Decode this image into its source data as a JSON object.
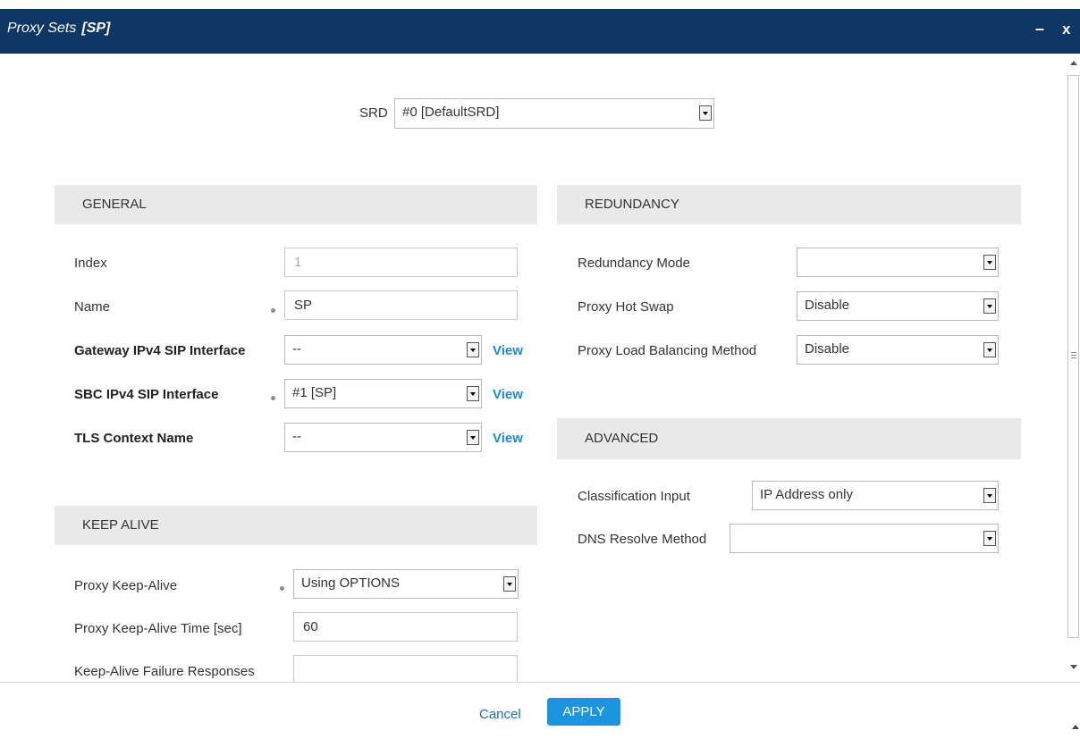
{
  "title": {
    "main": "Proxy Sets",
    "sub": "[SP]",
    "minimize": "–",
    "close": "x"
  },
  "srd": {
    "label": "SRD",
    "value": "#0 [DefaultSRD]"
  },
  "general": {
    "heading": "GENERAL",
    "index": {
      "label": "Index",
      "value": "1"
    },
    "name": {
      "label": "Name",
      "value": "SP"
    },
    "gateway_sip": {
      "label": "Gateway IPv4 SIP Interface",
      "value": "--",
      "link": "View"
    },
    "sbc_sip": {
      "label": "SBC IPv4 SIP Interface",
      "value": "#1 [SP]",
      "link": "View"
    },
    "tls": {
      "label": "TLS Context Name",
      "value": "--",
      "link": "View"
    }
  },
  "keep_alive": {
    "heading": "KEEP ALIVE",
    "proxy_keep_alive": {
      "label": "Proxy Keep-Alive",
      "value": "Using OPTIONS"
    },
    "keep_alive_time": {
      "label": "Proxy Keep-Alive Time [sec]",
      "value": "60"
    },
    "failure_responses": {
      "label": "Keep-Alive Failure Responses",
      "value": ""
    }
  },
  "redundancy": {
    "heading": "REDUNDANCY",
    "mode": {
      "label": "Redundancy Mode",
      "value": ""
    },
    "hot_swap": {
      "label": "Proxy Hot Swap",
      "value": "Disable"
    },
    "load_balancing": {
      "label": "Proxy Load Balancing Method",
      "value": "Disable"
    }
  },
  "advanced": {
    "heading": "ADVANCED",
    "classification": {
      "label": "Classification Input",
      "value": "IP Address only"
    },
    "dns_resolve": {
      "label": "DNS Resolve Method",
      "value": ""
    }
  },
  "footer": {
    "cancel": "Cancel",
    "apply": "APPLY"
  },
  "colors": {
    "titlebar": "#0e3766",
    "link": "#1b8ad4",
    "apply": "#1b95e0",
    "section": "#e9e9e9"
  }
}
